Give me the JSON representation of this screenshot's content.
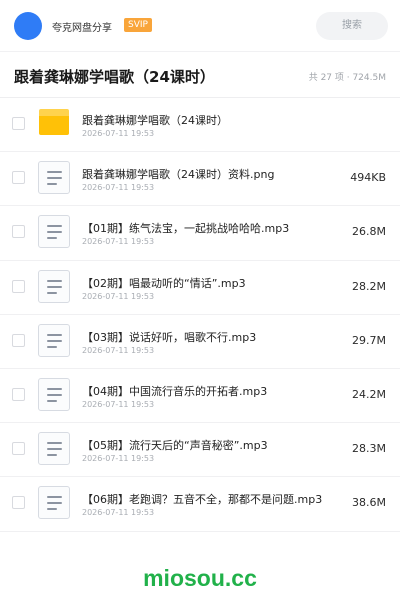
{
  "header": {
    "share_name": "夸克网盘分享",
    "badge": "SVIP",
    "search_placeholder": "搜索",
    "brand_color": "#2f7cf6",
    "badge_color": "#f9a53a"
  },
  "folder": {
    "title": "跟着龚琳娜学唱歌（24课时）",
    "summary": "共 27 项 · 724.5M"
  },
  "files": [
    {
      "type": "folder-icon",
      "name": "跟着龚琳娜学唱歌（24课时）",
      "date": "2026-07-11 19:53",
      "size": ""
    },
    {
      "type": "document-icon",
      "name": "跟着龚琳娜学唱歌（24课时）资料.png",
      "date": "2026-07-11 19:53",
      "size": "494KB"
    },
    {
      "type": "document-icon",
      "name": "【01期】练气法宝，一起挑战哈哈哈.mp3",
      "date": "2026-07-11 19:53",
      "size": "26.8M"
    },
    {
      "type": "document-icon",
      "name": "【02期】唱最动听的“情话”.mp3",
      "date": "2026-07-11 19:53",
      "size": "28.2M"
    },
    {
      "type": "document-icon",
      "name": "【03期】说话好听，唱歌不行.mp3",
      "date": "2026-07-11 19:53",
      "size": "29.7M"
    },
    {
      "type": "document-icon",
      "name": "【04期】中国流行音乐的开拓者.mp3",
      "date": "2026-07-11 19:53",
      "size": "24.2M"
    },
    {
      "type": "document-icon",
      "name": "【05期】流行天后的“声音秘密”.mp3",
      "date": "2026-07-11 19:53",
      "size": "28.3M"
    },
    {
      "type": "document-icon",
      "name": "【06期】老跑调？五音不全，那都不是问题.mp3",
      "date": "2026-07-11 19:53",
      "size": "38.6M"
    }
  ],
  "watermark": "miosou.cc"
}
